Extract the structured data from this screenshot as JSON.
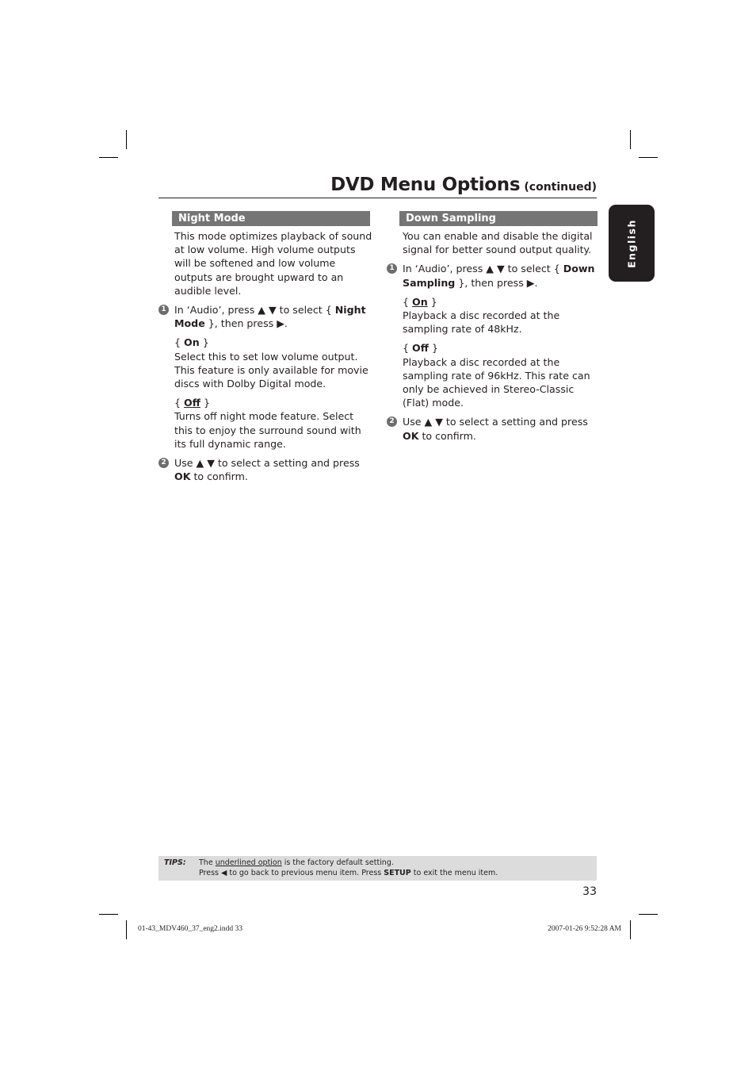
{
  "header": {
    "title": "DVD Menu Options",
    "title_suffix": "(continued)"
  },
  "language_tab": "English",
  "left_section": {
    "heading": "Night Mode",
    "intro": "This mode optimizes playback of sound at low volume. High volume outputs will be softened and low volume outputs are brought upward to an audible level.",
    "step1": {
      "number": "1",
      "text_before": "In ‘Audio’, press ▲ ▼ to select { ",
      "bold": "Night Mode",
      "text_after": " }, then press ▶."
    },
    "options": [
      {
        "brace_open": "{ ",
        "label": "On",
        "underlined": false,
        "brace_close": " }",
        "description": "Select this to set low volume output. This feature is only available for movie discs with Dolby Digital mode."
      },
      {
        "brace_open": "{ ",
        "label": "Off",
        "underlined": true,
        "brace_close": " }",
        "description": "Turns off night mode feature. Select this to enjoy the surround sound with its full dynamic range."
      }
    ],
    "step2": {
      "number": "2",
      "text_before": "Use ▲ ▼ to select a setting and press ",
      "bold": "OK",
      "text_after": " to confirm."
    }
  },
  "right_section": {
    "heading": "Down Sampling",
    "intro": "You can enable and disable the digital signal for better sound output quality.",
    "step1": {
      "number": "1",
      "text_before": "In ‘Audio’, press ▲ ▼ to select { ",
      "bold": "Down Sampling",
      "text_after": " }, then press ▶."
    },
    "options": [
      {
        "brace_open": "{ ",
        "label": "On",
        "underlined": true,
        "brace_close": " }",
        "description": "Playback a disc recorded at the sampling rate of 48kHz."
      },
      {
        "brace_open": "{ ",
        "label": "Off",
        "underlined": false,
        "brace_close": " }",
        "description": "Playback a disc recorded at the sampling rate of 96kHz. This rate can only be achieved in Stereo-Classic (Flat) mode."
      }
    ],
    "step2": {
      "number": "2",
      "text_before": "Use ▲ ▼ to select a setting and press ",
      "bold": "OK",
      "text_after": " to confirm."
    }
  },
  "tips": {
    "label": "TIPS:",
    "line1_before": "The ",
    "line1_underlined": "underlined option",
    "line1_after": " is the factory default setting.",
    "line2_before": "Press  ◀ to go back to previous menu item. Press ",
    "line2_bold": "SETUP",
    "line2_after": " to exit the menu item."
  },
  "page_number": "33",
  "slug": {
    "file": "01-43_MDV460_37_eng2.indd   33",
    "timestamp": "2007-01-26   9:52:28 AM"
  }
}
